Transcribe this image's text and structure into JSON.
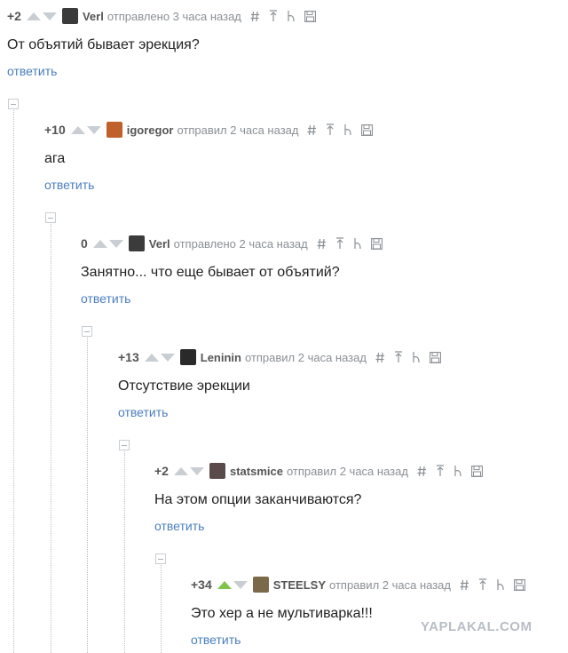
{
  "comments": [
    {
      "score": "+2",
      "user": "Verl",
      "meta": "отправлено 3 часа назад",
      "text": "От объятий бывает эрекция?",
      "reply": "ответить",
      "avatar_color": "#3b3b3b",
      "upvoted": false
    },
    {
      "score": "+10",
      "user": "igoregor",
      "meta": "отправил 2 часа назад",
      "text": "ага",
      "reply": "ответить",
      "avatar_color": "#c0602a",
      "upvoted": false
    },
    {
      "score": "0",
      "user": "Verl",
      "meta": "отправлено 2 часа назад",
      "text": "Занятно... что еще бывает от объятий?",
      "reply": "ответить",
      "avatar_color": "#3b3b3b",
      "upvoted": false
    },
    {
      "score": "+13",
      "user": "Leninin",
      "meta": "отправил 2 часа назад",
      "text": "Отсутствие эрекции",
      "reply": "ответить",
      "avatar_color": "#2a2a2a",
      "upvoted": false
    },
    {
      "score": "+2",
      "user": "statsmice",
      "meta": "отправил 2 часа назад",
      "text": "На этом опции заканчиваются?",
      "reply": "ответить",
      "avatar_color": "#5a4a4a",
      "upvoted": false
    },
    {
      "score": "+34",
      "user": "STEELSY",
      "meta": "отправил 2 часа назад",
      "text": "Это хер а не мультиварка!!!",
      "reply": "ответить",
      "avatar_color": "#7a6a4a",
      "upvoted": true
    }
  ],
  "tool_icons": [
    "hash-icon",
    "parent-arrow-icon",
    "branch-icon",
    "save-icon"
  ],
  "colors": {
    "link": "#4a7fbf",
    "upvote_active": "#7fc44a",
    "meta": "#8a9096"
  },
  "watermark": "YAPLAKAL.COM"
}
